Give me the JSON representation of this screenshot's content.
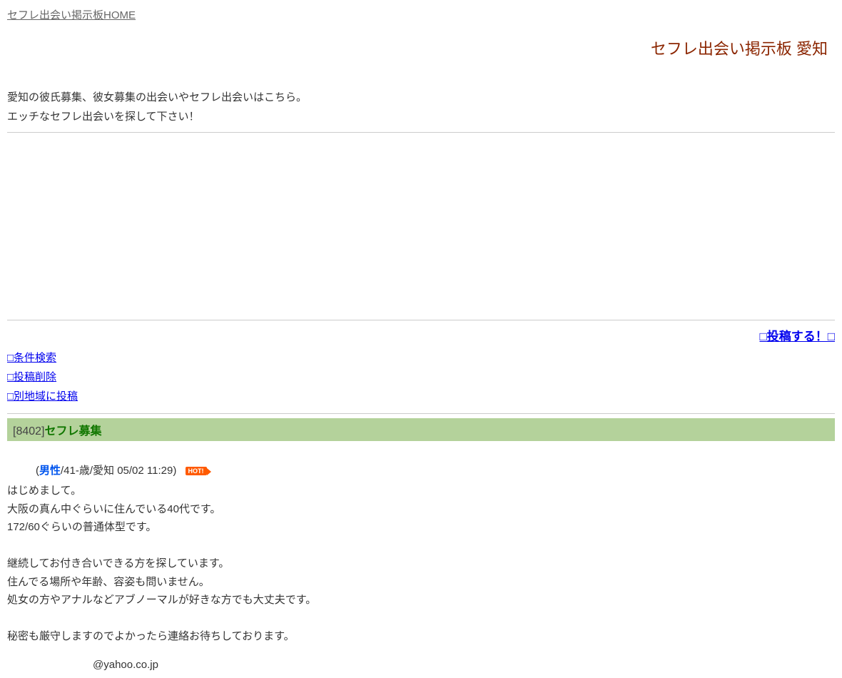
{
  "home_link_label": "セフレ出会い掲示板HOME",
  "page_title": "セフレ出会い掲示板 愛知",
  "intro_line1": "愛知の彼氏募集、彼女募集の出会いやセフレ出会いはこちら。",
  "intro_line2": "エッチなセフレ出会いを探して下さい！",
  "post_button_label": "□投稿する！□",
  "nav": {
    "search": "□条件検索",
    "delete": "□投稿削除",
    "other_region": "□別地域に投稿"
  },
  "post": {
    "id_bracket_open": "[",
    "id": "8402",
    "id_bracket_close": "]",
    "title": "セフレ募集",
    "meta_open": "(",
    "gender": "男性",
    "meta_rest": "/41-歳/愛知 05/02 11:29)",
    "hot_label": "HOT!",
    "body": "はじめまして。\n大阪の真ん中ぐらいに住んでいる40代です。\n172/60ぐらいの普通体型です。\n\n継続してお付き合いできる方を探しています。\n住んでる場所や年齢、容姿も問いません。\n処女の方やアナルなどアブノーマルが好きな方でも大丈夫です。\n\n秘密も厳守しますのでよかったら連絡お待ちしております。",
    "contact": "@yahoo.co.jp"
  }
}
